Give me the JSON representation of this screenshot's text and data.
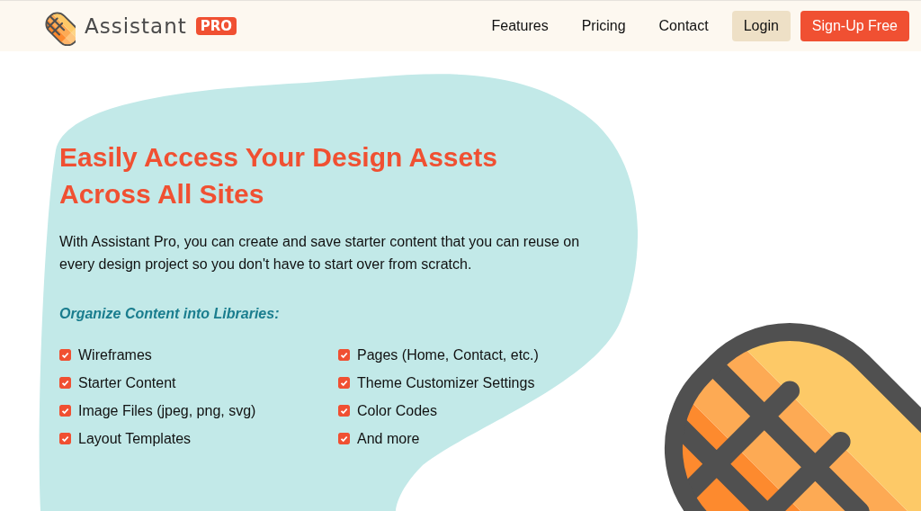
{
  "header": {
    "brand": "Assistant",
    "badge": "PRO",
    "nav": [
      {
        "label": "Features",
        "kind": "link"
      },
      {
        "label": "Pricing",
        "kind": "link"
      },
      {
        "label": "Contact",
        "kind": "link"
      },
      {
        "label": "Login",
        "kind": "secondary"
      },
      {
        "label": "Sign-Up Free",
        "kind": "primary"
      }
    ]
  },
  "hero": {
    "heading_lines": [
      "Easily Access Your Design Assets",
      "Across All Sites"
    ],
    "description": "With Assistant Pro, you can create and save starter content that you can reuse on every design project so you don't have to start over from scratch.",
    "list_title": "Organize Content into Libraries:",
    "items": [
      {
        "label": "Wireframes",
        "checked": true
      },
      {
        "label": "Starter Content",
        "checked": true
      },
      {
        "label": "Image Files (jpeg, png, svg)",
        "checked": true
      },
      {
        "label": "Layout Templates",
        "checked": true
      },
      {
        "label": "Pages (Home, Contact, etc.)",
        "checked": true
      },
      {
        "label": "Theme Customizer Settings",
        "checked": true
      },
      {
        "label": "Color Codes",
        "checked": true
      },
      {
        "label": "And more",
        "checked": true
      }
    ]
  }
}
